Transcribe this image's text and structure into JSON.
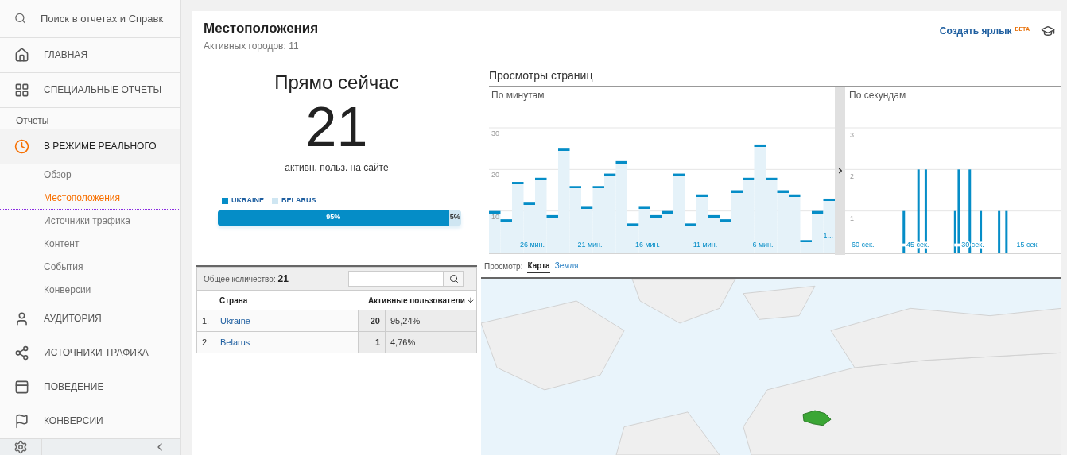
{
  "sidebar": {
    "search": {
      "placeholder": "Поиск в отчетах и Справк"
    },
    "items": [
      {
        "kind": "section",
        "label": "ГЛАВНАЯ",
        "selected": false
      },
      {
        "kind": "section",
        "label": "СПЕЦИАЛЬНЫЕ ОТЧЕТЫ",
        "selected": false
      },
      {
        "kind": "header",
        "label": "Отчеты"
      },
      {
        "kind": "section",
        "label": "В РЕЖИМЕ РЕАЛЬНОГО",
        "selected": true
      },
      {
        "kind": "sub",
        "label": "Обзор",
        "selected": false
      },
      {
        "kind": "sub",
        "label": "Местоположения",
        "selected": true
      },
      {
        "kind": "sub",
        "label": "Источники трафика",
        "selected": false
      },
      {
        "kind": "sub",
        "label": "Контент",
        "selected": false
      },
      {
        "kind": "sub",
        "label": "События",
        "selected": false
      },
      {
        "kind": "sub",
        "label": "Конверсии",
        "selected": false
      },
      {
        "kind": "section",
        "label": "АУДИТОРИЯ",
        "selected": false
      },
      {
        "kind": "section",
        "label": "ИСТОЧНИКИ ТРАФИКА",
        "selected": false
      },
      {
        "kind": "section",
        "label": "ПОВЕДЕНИЕ",
        "selected": false
      },
      {
        "kind": "section",
        "label": "КОНВЕРСИИ",
        "selected": false
      }
    ]
  },
  "header": {
    "title": "Местоположения",
    "subtitle": "Активных городов: 11",
    "shortcut_link": "Создать ярлык",
    "beta_badge": "БЕТА"
  },
  "now": {
    "title": "Прямо сейчас",
    "count": "21",
    "caption": "активн. польз. на сайте",
    "legend": [
      {
        "label": "UKRAINE",
        "color": "#058dc7"
      },
      {
        "label": "BELARUS",
        "color": "#cfe6f2"
      }
    ],
    "share_bar": [
      {
        "label": "95%",
        "level": 0.95,
        "color": "#058dc7"
      },
      {
        "label": "5%",
        "level": 0.05,
        "color": "#cfe6f2"
      }
    ]
  },
  "pageviews": {
    "title": "Просмотры страниц",
    "per_minute": {
      "label": "По минутам",
      "chart_data": {
        "type": "bar",
        "ylim": [
          0,
          30
        ],
        "yticks": [
          10,
          20,
          30
        ],
        "xlim": [
          -29.5,
          0.5
        ],
        "x": [
          -29,
          -28,
          -27,
          -26,
          -25,
          -24,
          -23,
          -22,
          -21,
          -20,
          -19,
          -18,
          -17,
          -16,
          -15,
          -14,
          -13,
          -12,
          -11,
          -10,
          -9,
          -8,
          -7,
          -6,
          -5,
          -4,
          -3,
          -2,
          -1,
          0
        ],
        "values": [
          10,
          8,
          17,
          12,
          18,
          9,
          25,
          16,
          11,
          16,
          19,
          22,
          7,
          11,
          9,
          10,
          19,
          7,
          14,
          9,
          8,
          15,
          18,
          26,
          18,
          15,
          14,
          3,
          10,
          13
        ],
        "xticks": [
          {
            "value": -26,
            "label": "– 26 мин."
          },
          {
            "value": -21,
            "label": "– 21 мин."
          },
          {
            "value": -16,
            "label": "– 16 мин."
          },
          {
            "value": -11,
            "label": "– 11 мин."
          },
          {
            "value": -6,
            "label": "– 6 мин."
          },
          {
            "value": 0,
            "label": "–"
          }
        ],
        "annotations": [
          "1..."
        ]
      }
    },
    "per_second": {
      "label": "По секундам",
      "chart_data": {
        "type": "bar",
        "ylim": [
          0,
          3
        ],
        "yticks": [
          1,
          2,
          3
        ],
        "xlim": [
          -64,
          -5
        ],
        "x": [
          -48,
          -44,
          -42,
          -34,
          -33,
          -30,
          -27,
          -22,
          -20
        ],
        "values": [
          1,
          2,
          2,
          1,
          2,
          2,
          1,
          1,
          1
        ],
        "xticks": [
          {
            "value": -60,
            "label": "– 60 сек."
          },
          {
            "value": -45,
            "label": "– 45 сек."
          },
          {
            "value": -30,
            "label": "– 30 сек."
          },
          {
            "value": -15,
            "label": "– 15 сек."
          }
        ]
      }
    }
  },
  "table": {
    "total_label": "Общее количество:",
    "total": "21",
    "columns": [
      "Страна",
      "Активные пользователи"
    ],
    "rows": [
      {
        "index": "1.",
        "country": "Ukraine",
        "users": "20",
        "percent": "95,24%"
      },
      {
        "index": "2.",
        "country": "Belarus",
        "users": "1",
        "percent": "4,76%"
      }
    ]
  },
  "map": {
    "view_label": "Просмотр:",
    "tabs": [
      {
        "label": "Карта",
        "selected": true
      },
      {
        "label": "Земля",
        "selected": false
      }
    ]
  }
}
